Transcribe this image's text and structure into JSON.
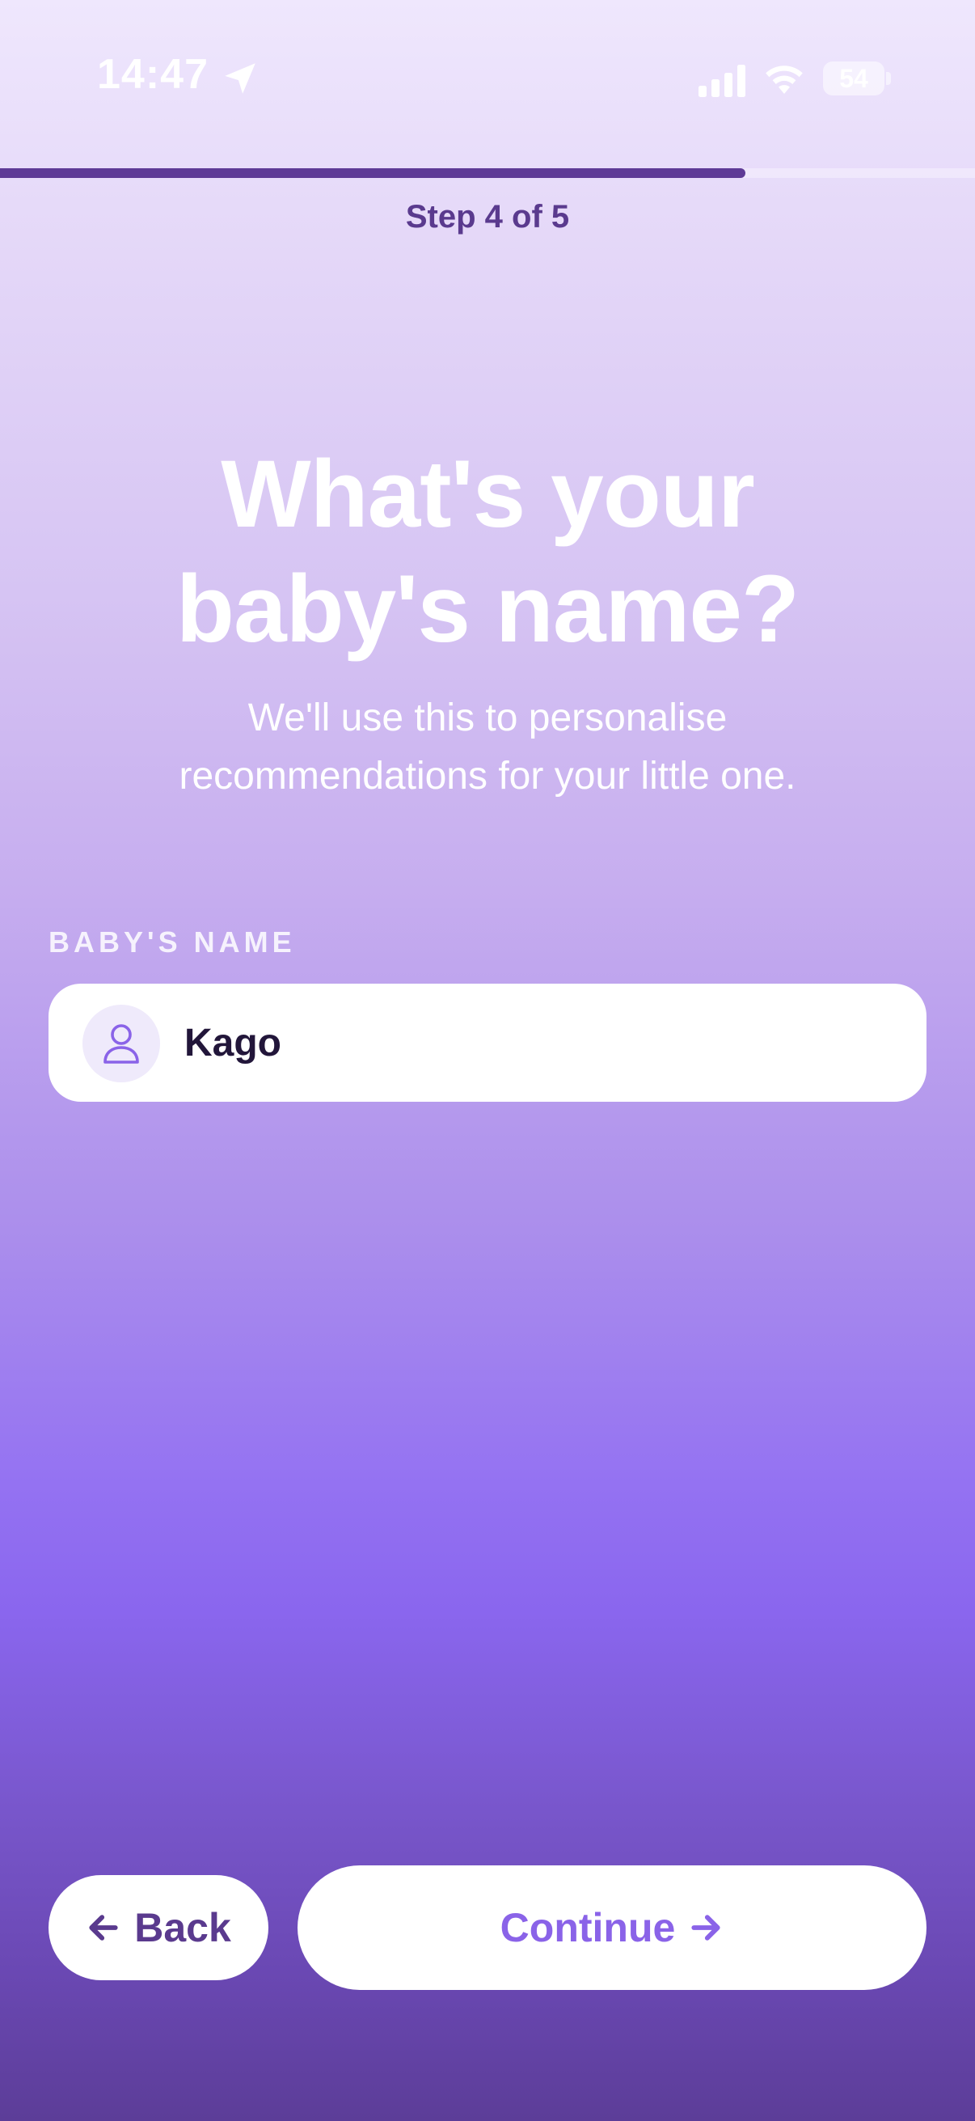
{
  "status_bar": {
    "time": "14:47",
    "battery_level": "54",
    "icons": [
      "location-arrow-icon",
      "cellular-signal-icon",
      "wifi-icon",
      "battery-icon"
    ]
  },
  "progress": {
    "label": "Step 4 of 5",
    "fraction": 0.8
  },
  "header": {
    "title_line1": "What's your",
    "title_line2": "baby's name?",
    "subtitle_line1": "We'll use this to personalise",
    "subtitle_line2": "recommendations for your little one."
  },
  "form": {
    "name_label": "BABY'S NAME",
    "name_value": "Kago",
    "name_icon": "person-icon"
  },
  "footer": {
    "back_label": "Back",
    "continue_label": "Continue"
  },
  "colors": {
    "accent": "#8a63e8",
    "dark_purple": "#5a3a8e",
    "progress_fill": "#5e3a96"
  }
}
